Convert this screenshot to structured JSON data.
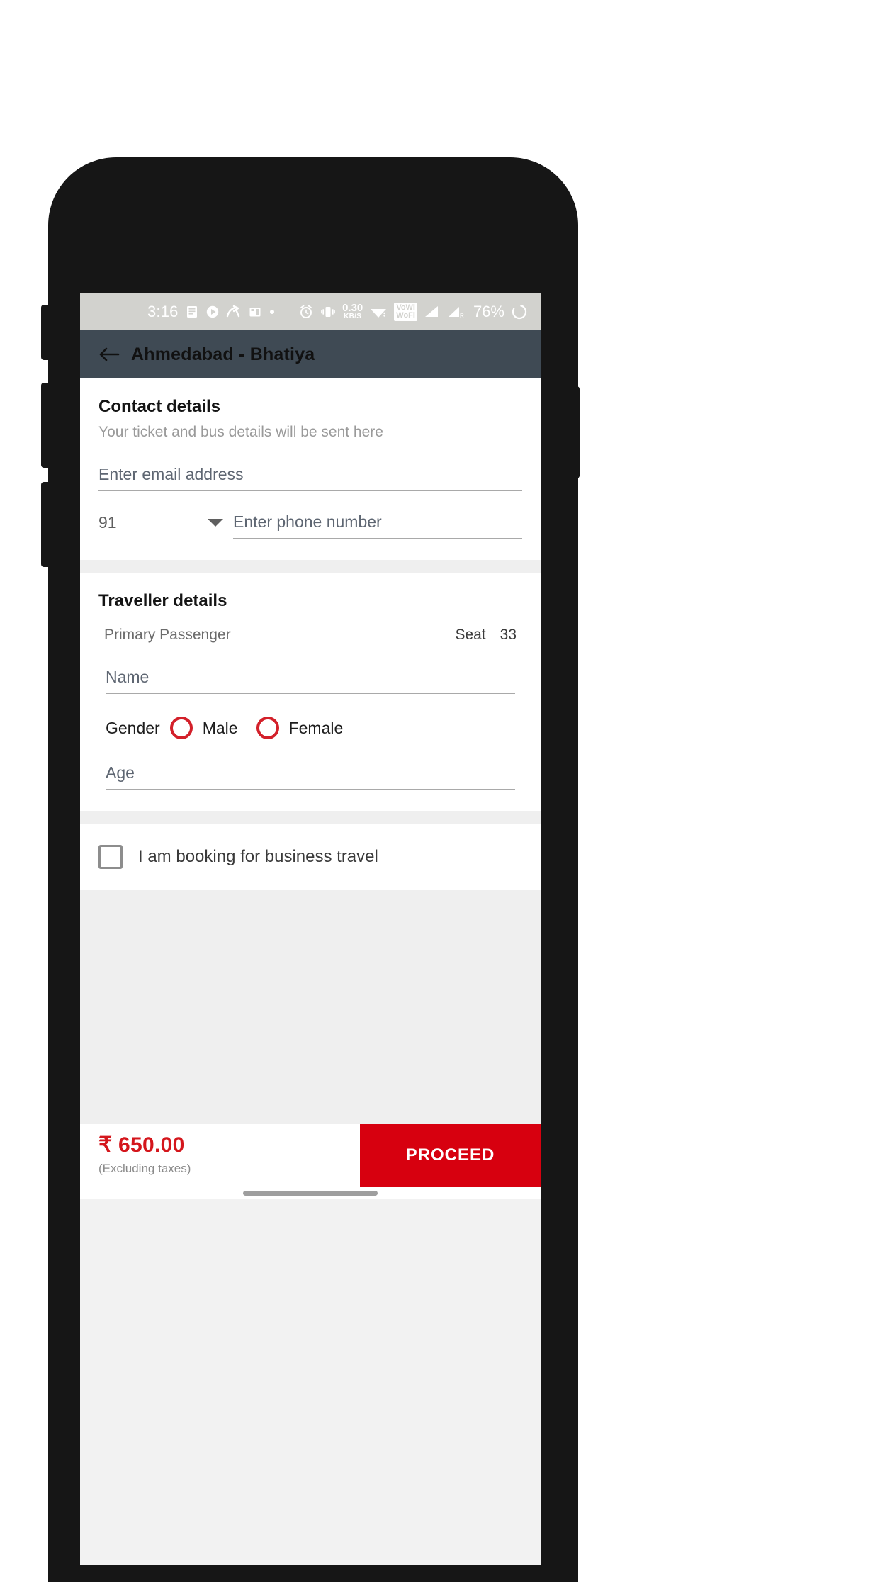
{
  "status_bar": {
    "time": "3:16",
    "left_icons": [
      "notes-icon",
      "play-circle-icon",
      "share-arrow-icon",
      "screenshot-icon",
      "dot-icon"
    ],
    "alarm_icon": "alarm-icon",
    "vibrate_icon": "vibrate-icon",
    "net_speed_value": "0.30",
    "net_speed_unit": "KB/S",
    "wifi_icon": "wifi-icon",
    "vowifi_line1": "VoWi",
    "vowifi_line2": "WoFi",
    "signal_1_icon": "signal-bars-icon",
    "signal_2_icon": "signal-bars-roaming-icon",
    "roaming_letter": "R",
    "battery": "76%",
    "battery_ring_icon": "battery-circle-icon",
    "bg_color": "#d2d2ce"
  },
  "app_bar": {
    "back_icon": "back-arrow-icon",
    "title": "Ahmedabad - Bhatiya",
    "bg_color": "#3f4a54"
  },
  "contact": {
    "title": "Contact details",
    "subtitle": "Your ticket and bus details will be sent here",
    "email_placeholder": "Enter email address",
    "email_value": "",
    "country_code": "91",
    "country_caret_icon": "chevron-down-icon",
    "phone_placeholder": "Enter phone number",
    "phone_value": ""
  },
  "traveller": {
    "title": "Traveller details",
    "passenger_label": "Primary Passenger",
    "seat_label": "Seat",
    "seat_number": "33",
    "name_placeholder": "Name",
    "name_value": "",
    "gender_label": "Gender",
    "gender_options": [
      "Male",
      "Female"
    ],
    "gender_selected": "",
    "gender_accent_color": "#d3202a",
    "age_placeholder": "Age",
    "age_value": ""
  },
  "business": {
    "checkbox_label": "I am booking for business travel",
    "checked": false
  },
  "bottom": {
    "price": "₹ 650.00",
    "price_note": "(Excluding taxes)",
    "price_color": "#d4161c",
    "proceed_label": "PROCEED",
    "proceed_bg": "#d7000f"
  }
}
